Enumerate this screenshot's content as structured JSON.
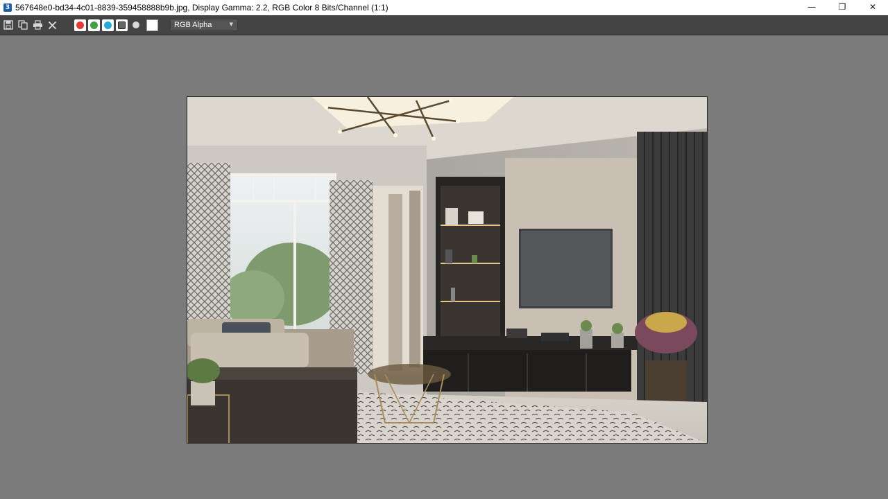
{
  "window": {
    "title": "567648e0-bd34-4c01-8839-359458888b9b.jpg, Display Gamma: 2.2, RGB Color 8 Bits/Channel (1:1)",
    "app_icon_glyph": "3",
    "controls": {
      "minimize_glyph": "—",
      "restore_glyph": "❐",
      "close_glyph": "✕"
    }
  },
  "toolbar": {
    "icons": [
      "save-icon",
      "copy-icon",
      "print-icon",
      "clear-icon"
    ],
    "channels": [
      {
        "name": "red-channel",
        "color": "#e53935"
      },
      {
        "name": "green-channel",
        "color": "#43a047"
      },
      {
        "name": "blue-channel",
        "color": "#26a9d9"
      }
    ],
    "channel_select": {
      "value": "RGB Alpha"
    }
  },
  "viewport": {
    "background": "#7b7b7b"
  }
}
